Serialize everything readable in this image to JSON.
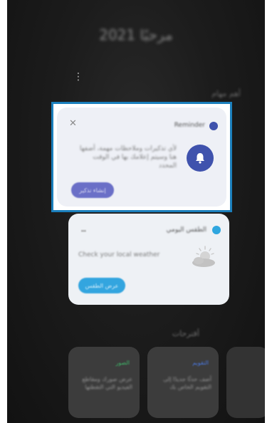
{
  "background": {
    "greeting": "مرحبًا 2021",
    "section_label": "أهم مهام",
    "suggestions_label": "أقترحات"
  },
  "reminder_card": {
    "app_name": "Reminder",
    "description": "لأي تذكيرات وملاحظات مهمة، أضفها هنا وسيتم إعلامك بها في الوقت المحدد",
    "button_label": "إنشاء تذكير",
    "accent_color": "#3f52ad"
  },
  "weather_card": {
    "app_name": "الطقس اليومي",
    "body_text": "Check your local weather",
    "button_label": "عرض الطقس",
    "accent_color": "#2fa6df"
  },
  "suggestion_cards": [
    {
      "tag": "الصور",
      "tag_color": "#3fb86a",
      "text": "عرض صورك ومقاطع الفيديو التي التقطتها"
    },
    {
      "tag": "التقويم",
      "tag_color": "#4a78e0",
      "text": "أضف حدثًا جديدًا إلى التقويم الخاص بك"
    }
  ]
}
